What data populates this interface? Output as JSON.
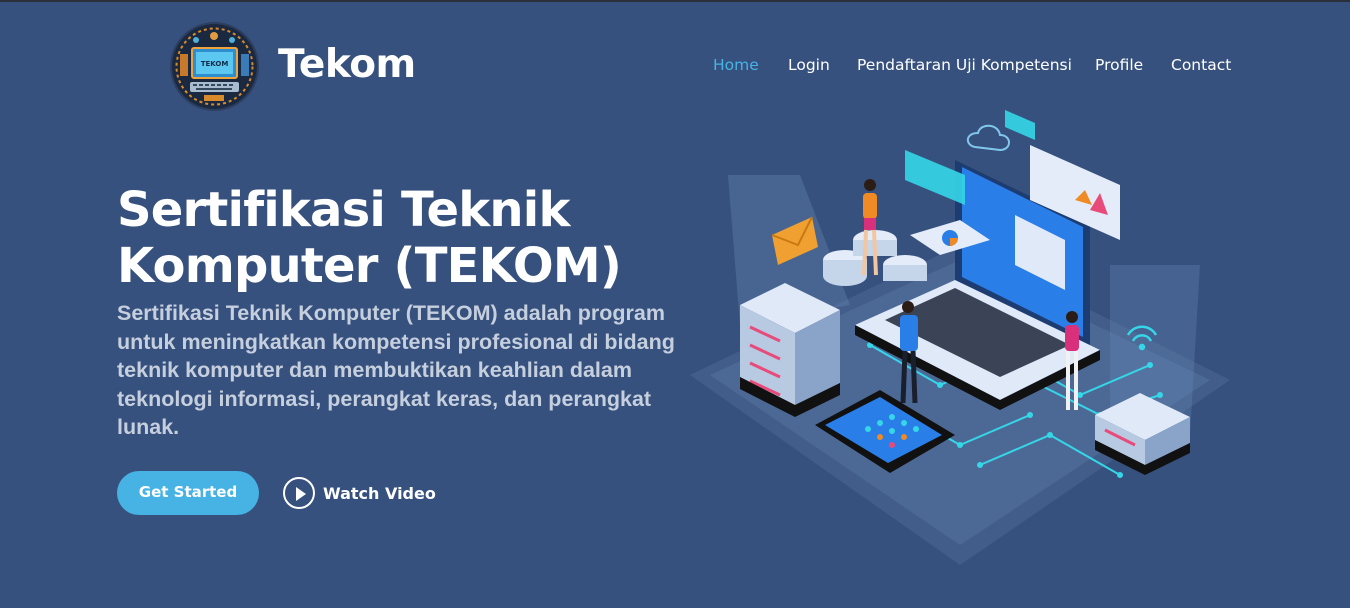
{
  "brand": {
    "name": "Tekom",
    "badge_text": "TEKOM"
  },
  "nav": {
    "home": "Home",
    "login": "Login",
    "register": "Pendaftaran Uji Kompetensi",
    "profile": "Profile",
    "contact": "Contact"
  },
  "hero": {
    "title": "Sertifikasi Teknik Komputer (TEKOM)",
    "description": "Sertifikasi Teknik Komputer (TEKOM) adalah program untuk meningkatkan kompetensi profesional di bidang teknik komputer dan membuktikan keahlian dalam teknologi informasi, perangkat keras, dan perangkat lunak.",
    "get_started": "Get Started",
    "watch_video": "Watch Video"
  },
  "colors": {
    "background": "#37517e",
    "accent": "#47b2e4",
    "active_nav": "#47b2e4",
    "text_muted": "#c6cfdd"
  },
  "icons": {
    "play": "play-circle-icon",
    "logo": "computer-logo-icon"
  }
}
